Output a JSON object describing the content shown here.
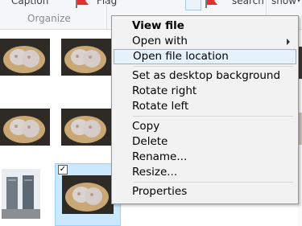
{
  "ribbon": {
    "caption_label": "Caption",
    "flag_label": "Flag",
    "search_label": "search",
    "show_label": "show",
    "group_label": "Organize"
  },
  "context_menu": {
    "items": [
      {
        "label": "View file",
        "bold": true
      },
      {
        "label": "Open with",
        "has_submenu": true
      },
      {
        "label": "Open file location",
        "highlighted": true
      },
      {
        "label": "Set as desktop background"
      },
      {
        "label": "Rotate right"
      },
      {
        "label": "Rotate left"
      },
      {
        "label": "Copy"
      },
      {
        "label": "Delete"
      },
      {
        "label": "Rename..."
      },
      {
        "label": "Resize..."
      },
      {
        "label": "Properties"
      }
    ]
  },
  "thumbnails": {
    "selected_checkbox": "✓"
  },
  "colors": {
    "highlight_fill": "#e5f1fb",
    "highlight_border": "#83b6e0",
    "selection_fill": "#cce8ff"
  }
}
